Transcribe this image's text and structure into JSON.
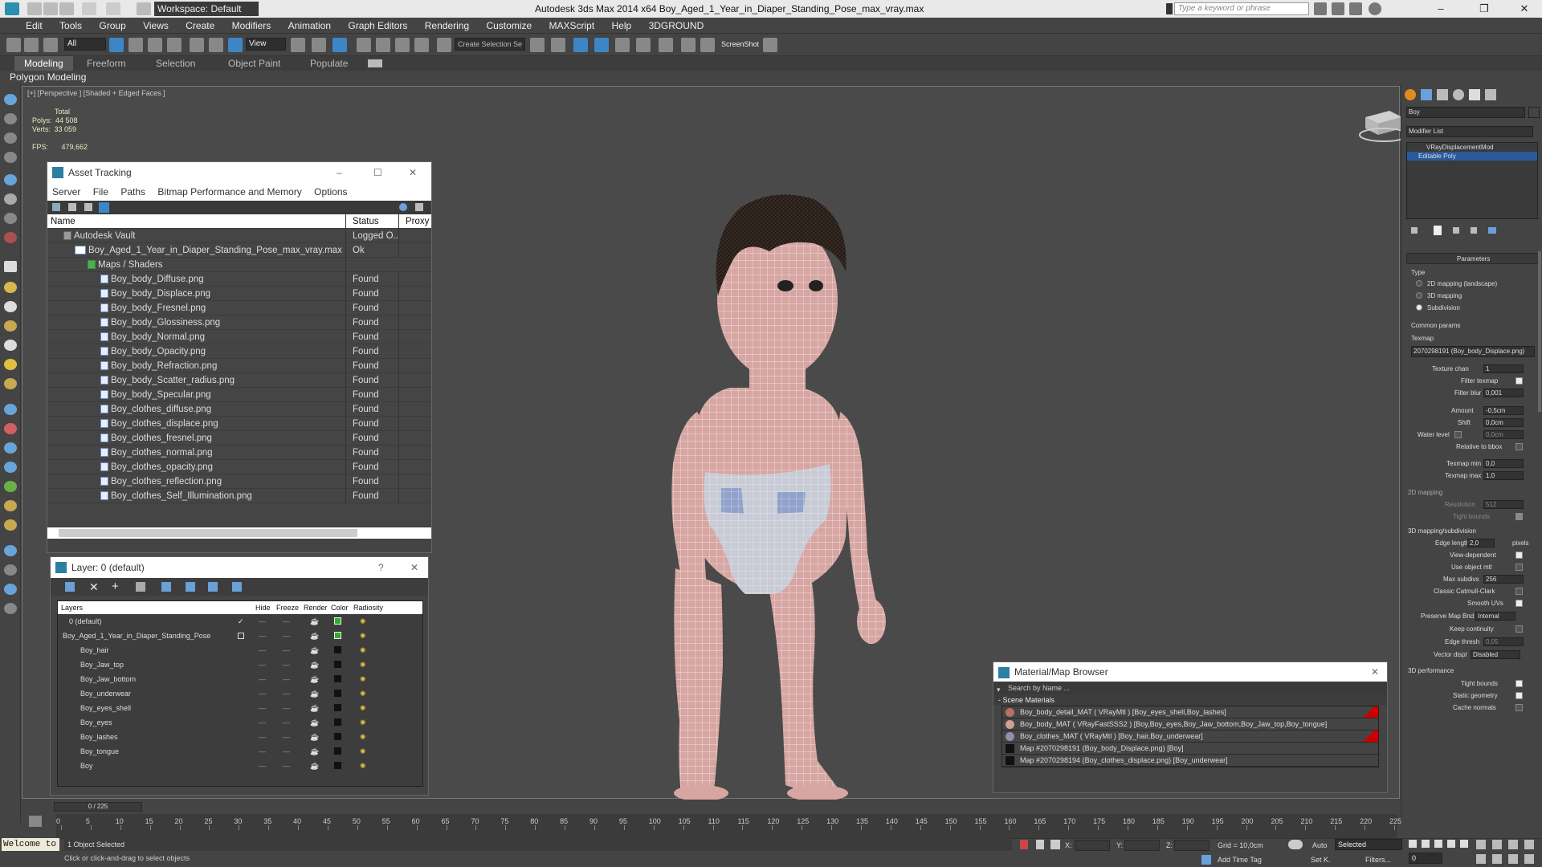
{
  "app": {
    "workspace": "Workspace: Default",
    "title": "Autodesk 3ds Max  2014 x64     Boy_Aged_1_Year_in_Diaper_Standing_Pose_max_vray.max",
    "search_placeholder": "Type a keyword or phrase"
  },
  "menu": [
    "Edit",
    "Tools",
    "Group",
    "Views",
    "Create",
    "Modifiers",
    "Animation",
    "Graph Editors",
    "Rendering",
    "Customize",
    "MAXScript",
    "Help",
    "3DGROUND"
  ],
  "toolbar": {
    "filter": "All",
    "view": "View",
    "named_sel": "Create Selection Se",
    "screenshot": "ScreenShot"
  },
  "ribbon": {
    "tabs": [
      "Modeling",
      "Freeform",
      "Selection",
      "Object Paint",
      "Populate"
    ],
    "sub": "Polygon Modeling"
  },
  "viewport": {
    "label": "[+] [Perspective ] [Shaded + Edged Faces ]",
    "stats": {
      "total": "Total",
      "polys_label": "Polys:",
      "polys": "44 508",
      "verts_label": "Verts:",
      "verts": "33 059",
      "fps_label": "FPS:",
      "fps": "479,662"
    }
  },
  "asset_tracking": {
    "title": "Asset Tracking",
    "menu": [
      "Server",
      "File",
      "Paths",
      "Bitmap Performance and Memory",
      "Options"
    ],
    "columns": [
      "Name",
      "Status",
      "Proxy R"
    ],
    "rows": [
      {
        "name": "Autodesk Vault",
        "status": "Logged O..."
      },
      {
        "name": "Boy_Aged_1_Year_in_Diaper_Standing_Pose_max_vray.max",
        "status": "Ok"
      },
      {
        "name": "Maps / Shaders",
        "status": ""
      },
      {
        "name": "Boy_body_Diffuse.png",
        "status": "Found"
      },
      {
        "name": "Boy_body_Displace.png",
        "status": "Found"
      },
      {
        "name": "Boy_body_Fresnel.png",
        "status": "Found"
      },
      {
        "name": "Boy_body_Glossiness.png",
        "status": "Found"
      },
      {
        "name": "Boy_body_Normal.png",
        "status": "Found"
      },
      {
        "name": "Boy_body_Opacity.png",
        "status": "Found"
      },
      {
        "name": "Boy_body_Refraction.png",
        "status": "Found"
      },
      {
        "name": "Boy_body_Scatter_radius.png",
        "status": "Found"
      },
      {
        "name": "Boy_body_Specular.png",
        "status": "Found"
      },
      {
        "name": "Boy_clothes_diffuse.png",
        "status": "Found"
      },
      {
        "name": "Boy_clothes_displace.png",
        "status": "Found"
      },
      {
        "name": "Boy_clothes_fresnel.png",
        "status": "Found"
      },
      {
        "name": "Boy_clothes_normal.png",
        "status": "Found"
      },
      {
        "name": "Boy_clothes_opacity.png",
        "status": "Found"
      },
      {
        "name": "Boy_clothes_reflection.png",
        "status": "Found"
      },
      {
        "name": "Boy_clothes_Self_Illumination.png",
        "status": "Found"
      }
    ]
  },
  "layer_explorer": {
    "title": "Layer: 0 (default)",
    "help": "?",
    "columns": [
      "Layers",
      "Hide",
      "Freeze",
      "Render",
      "Color",
      "Radiosity"
    ],
    "rows": [
      "0 (default)",
      "Boy_Aged_1_Year_in_Diaper_Standing_Pose",
      "Boy_hair",
      "Boy_Jaw_top",
      "Boy_Jaw_bottom",
      "Boy_underwear",
      "Boy_eyes_shell",
      "Boy_eyes",
      "Boy_lashes",
      "Boy_tongue",
      "Boy"
    ]
  },
  "material_browser": {
    "title": "Material/Map Browser",
    "search": "Search by Name ...",
    "section": "- Scene Materials",
    "rows": [
      "Boy_body_detail_MAT ( VRayMtl ) [Boy_eyes_shell,Boy_lashes]",
      "Boy_body_MAT ( VRayFastSSS2 ) [Boy,Boy_eyes,Boy_Jaw_bottom,Boy_Jaw_top,Boy_tongue]",
      "Boy_clothes_MAT ( VRayMtl ) [Boy_hair,Boy_underwear]",
      "Map #2070298191 (Boy_body_Displace.png) [Boy]",
      "Map #2070298194 (Boy_clothes_displace.png) [Boy_underwear]"
    ]
  },
  "command_panel": {
    "object_name": "Boy",
    "modifier_list": "Modifier List",
    "stack": [
      "VRayDisplacementMod",
      "Editable Poly"
    ],
    "parameters": "Parameters",
    "type_label": "Type",
    "type_options": [
      "2D mapping (landscape)",
      "3D mapping",
      "Subdivision"
    ],
    "common": "Common params",
    "texmap_label": "Texmap",
    "texmap": "2070298191 (Boy_body_Displace.png)",
    "fields": [
      {
        "label": "Texture chan",
        "value": "1"
      },
      {
        "label": "Filter texmap",
        "value": ""
      },
      {
        "label": "Filter blur",
        "value": "0,001"
      },
      {
        "label": "Amount",
        "value": "-0,5cm"
      },
      {
        "label": "Shift",
        "value": "0,0cm"
      },
      {
        "label": "Water level",
        "value": "0,0cm"
      },
      {
        "label": "Relative to bbox",
        "value": ""
      },
      {
        "label": "Texmap min",
        "value": "0,0"
      },
      {
        "label": "Texmap max",
        "value": "1,0"
      }
    ],
    "map2d": "2D mapping",
    "resolution_label": "Resolution",
    "resolution": "512",
    "tight_label": "Tight bounds",
    "sub_section": "3D mapping/subdivision",
    "edge_len_label": "Edge length",
    "edge_len": "2,0",
    "pixels": "pixels",
    "view_dep": "View-dependent",
    "use_obj": "Use object mtl",
    "max_subdivs_label": "Max subdivs",
    "max_subdivs": "256",
    "catmull": "Classic Catmull-Clark",
    "smooth_uvs": "Smooth UVs",
    "preserve_label": "Preserve Map Bnd",
    "preserve": "Internal",
    "keep_cont": "Keep continuity",
    "edge_thresh_label": "Edge thresh",
    "edge_thresh": "0,05",
    "vector_label": "Vector displ",
    "vector": "Disabled",
    "perf": "3D performance",
    "perf_opts": [
      "Tight bounds",
      "Static geometry",
      "Cache normals"
    ]
  },
  "timeline": {
    "counter": "0 / 225",
    "ticks": [
      "0",
      "5",
      "10",
      "15",
      "20",
      "25",
      "30",
      "35",
      "40",
      "45",
      "50",
      "55",
      "60",
      "65",
      "70",
      "75",
      "80",
      "85",
      "90",
      "95",
      "100",
      "105",
      "110",
      "115",
      "120",
      "125",
      "130",
      "135",
      "140",
      "145",
      "150",
      "155",
      "160",
      "165",
      "170",
      "175",
      "180",
      "185",
      "190",
      "195",
      "200",
      "205",
      "210",
      "215",
      "220",
      "225"
    ]
  },
  "status": {
    "welcome": "Welcome to",
    "selected": "1 Object Selected",
    "prompt": "Click or click-and-drag to select objects",
    "x": "X:",
    "y": "Y:",
    "z": "Z:",
    "grid": "Grid = 10,0cm",
    "add_tag": "Add Time Tag",
    "auto": "Auto",
    "selected_dd": "Selected",
    "setk": "Set K.",
    "filters": "Filters...",
    "frame": "0"
  }
}
